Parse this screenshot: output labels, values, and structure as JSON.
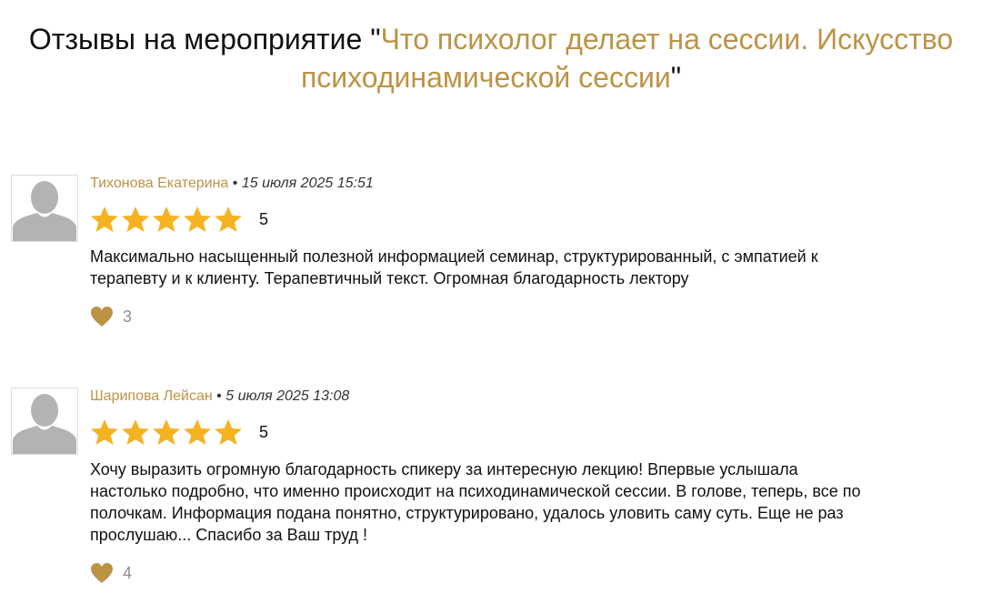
{
  "page": {
    "title_prefix": "Отзывы на мероприятие \"",
    "event_name": "Что психолог делает на сессии. Искусство психодинамической сессии",
    "title_suffix": "\""
  },
  "colors": {
    "accent": "#bc9345",
    "star": "#f5b321",
    "heart": "#bc9345",
    "muted": "#8f8f8f"
  },
  "icons": {
    "avatar": "default-user-avatar-icon",
    "star": "star-icon",
    "like": "heart-icon"
  },
  "reviews": [
    {
      "author": "Тихонова Екатерина",
      "separator": "•",
      "date": "15 июля 2025 15:51",
      "rating": 5,
      "rating_label": "5",
      "text": "Максимально насыщенный полезной информацией семинар, структурированный, с эмпатией к\nтерапевту и к клиенту. Терапевтичный текст. Огромная благодарность лектору",
      "likes": "3"
    },
    {
      "author": "Шарипова Лейсан",
      "separator": "•",
      "date": "5 июля 2025 13:08",
      "rating": 5,
      "rating_label": "5",
      "text": "Хочу выразить огромную благодарность спикеру за интересную лекцию! Впервые услышала\nнастолько подробно, что именно происходит на психодинамической сессии. В голове, теперь, все по\nполочкам. Информация подана понятно, структурировано, удалось уловить саму суть. Еще не раз\nпрослушаю... Спасибо за Ваш труд !",
      "likes": "4"
    }
  ]
}
